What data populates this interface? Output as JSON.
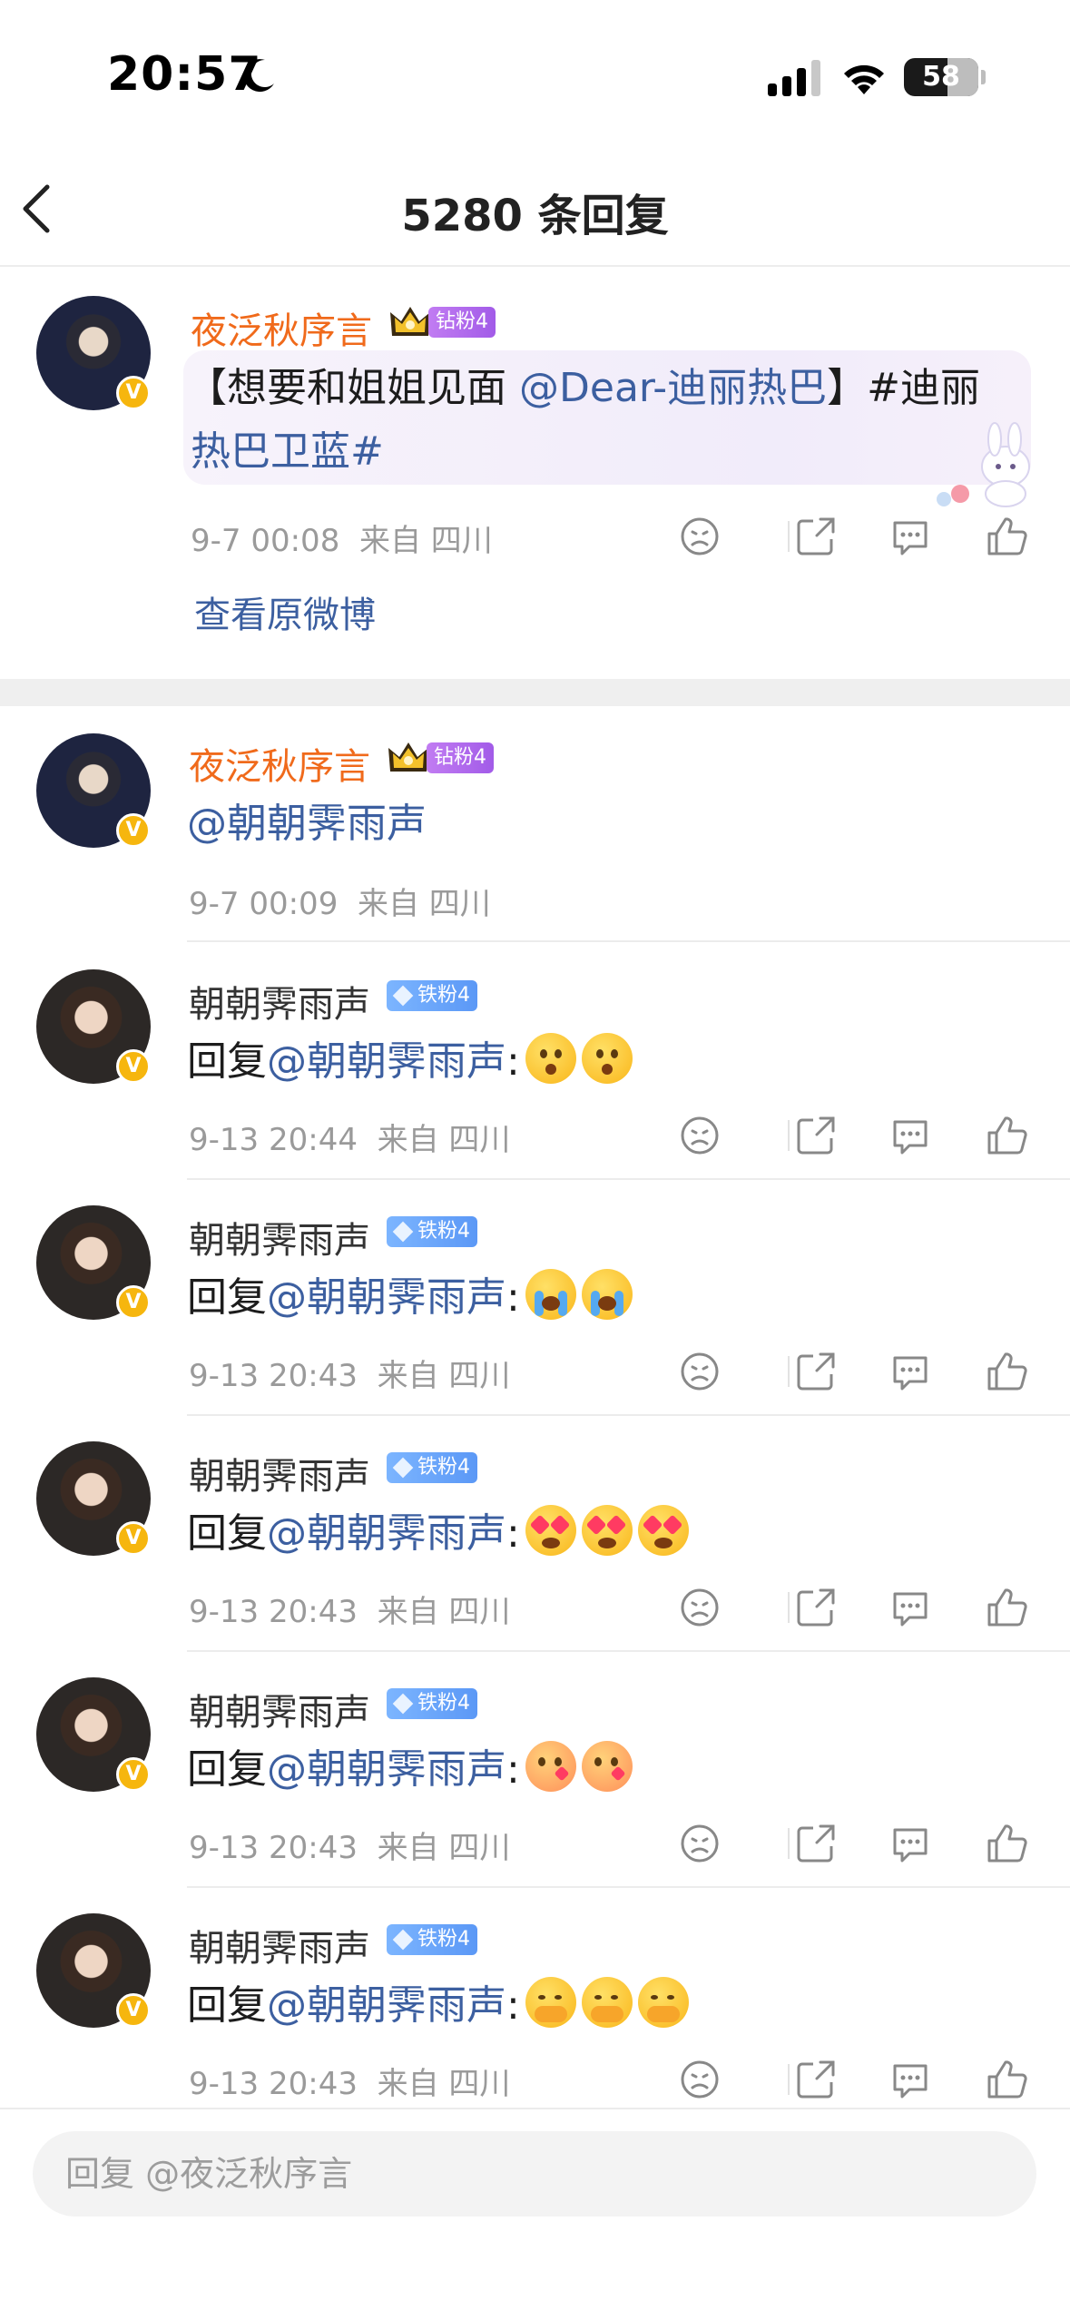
{
  "status_bar": {
    "time": "20:57",
    "battery": "58",
    "battery_level": 0.58
  },
  "header": {
    "title": "5280 条回复"
  },
  "root_comment": {
    "username": "夜泛秋序言",
    "fan_badge": "钻粉4",
    "text_prefix": "【想要和姐姐见面 ",
    "mention": "@Dear-迪丽热巴",
    "text_suffix": "】#迪丽",
    "text_line2": "热巴卫蓝#",
    "time": "9-7 00:08",
    "location": "来自 四川",
    "view_original": "查看原微博"
  },
  "replies": [
    {
      "username": "夜泛秋序言",
      "fan_badge": "钻粉4",
      "mention": "@朝朝霁雨声",
      "time": "9-7 00:09",
      "location": "来自 四川"
    },
    {
      "username": "朝朝霁雨声",
      "fan_badge": "铁粉4",
      "prefix": "回复",
      "mention": "@朝朝霁雨声",
      "colon": ":",
      "emoji": [
        "surprised",
        "surprised"
      ],
      "time": "9-13 20:44",
      "location": "来自 四川"
    },
    {
      "username": "朝朝霁雨声",
      "fan_badge": "铁粉4",
      "prefix": "回复",
      "mention": "@朝朝霁雨声",
      "colon": ":",
      "emoji": [
        "crying",
        "crying"
      ],
      "time": "9-13 20:43",
      "location": "来自 四川"
    },
    {
      "username": "朝朝霁雨声",
      "fan_badge": "铁粉4",
      "prefix": "回复",
      "mention": "@朝朝霁雨声",
      "colon": ":",
      "emoji": [
        "heart-eyes",
        "heart-eyes",
        "heart-eyes"
      ],
      "time": "9-13 20:43",
      "location": "来自 四川"
    },
    {
      "username": "朝朝霁雨声",
      "fan_badge": "铁粉4",
      "prefix": "回复",
      "mention": "@朝朝霁雨声",
      "colon": ":",
      "emoji": [
        "kissing-heart",
        "kissing-heart"
      ],
      "time": "9-13 20:43",
      "location": "来自 四川"
    },
    {
      "username": "朝朝霁雨声",
      "fan_badge": "铁粉4",
      "prefix": "回复",
      "mention": "@朝朝霁雨声",
      "colon": ":",
      "emoji": [
        "hand-over-mouth",
        "hand-over-mouth",
        "hand-over-mouth"
      ],
      "time": "9-13 20:43",
      "location": "来自 四川"
    }
  ],
  "reply_input": {
    "placeholder": "回复 @夜泛秋序言"
  },
  "colors": {
    "mention": "#3c5fa0",
    "username_highlight": "#f06a1b",
    "meta": "#9a9a9a",
    "verified": "#f6b60e"
  }
}
